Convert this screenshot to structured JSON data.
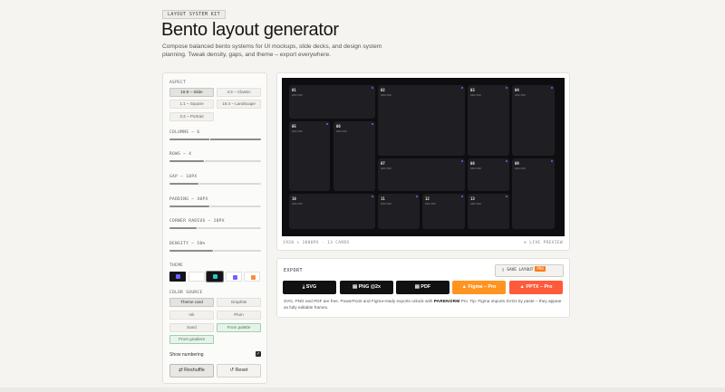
{
  "header": {
    "tag": "LAYOUT SYSTEM KIT",
    "title": "Bento layout generator",
    "subtitle": "Compose balanced bento systems for UI mockups, slide decks, and design system planning. Tweak density, gaps, and theme – export everywhere."
  },
  "controls": {
    "aspect_label": "ASPECT",
    "aspects": [
      "16:9 – Slide",
      "4:3 – Classic",
      "1:1 – Square",
      "16:4 – Landscape",
      "3:4 – Portrait"
    ],
    "columns_label": "COLUMNS – 6",
    "rows_label": "ROWS – 4",
    "gap_label": "GAP – 18PX",
    "padding_label": "PADDING – 40PX",
    "radius_label": "CORNER RADIUS – 20PX",
    "density_label": "DENSITY – 50%",
    "theme_label": "THEME",
    "theme_colors": [
      "#6b63ff",
      "#ffffff",
      "#2ec5c5",
      "#6b63ff",
      "#ff8a3d"
    ],
    "color_source_label": "COLOR SOURCE",
    "color_sources": [
      "Theme card",
      "Graphite",
      "Ink",
      "Plum",
      "Sand",
      "From palette",
      "From gradient"
    ],
    "numbering_label": "Show numbering",
    "reshuffle": "Reshuffle",
    "reset": "Reset"
  },
  "preview": {
    "cells": [
      {
        "n": "01",
        "m": "640×360"
      },
      {
        "n": "02",
        "m": "640×360"
      },
      {
        "n": "03",
        "m": "640×360"
      },
      {
        "n": "04",
        "m": "640×360"
      },
      {
        "n": "05",
        "m": "640×360"
      },
      {
        "n": "06",
        "m": "640×360"
      },
      {
        "n": "07",
        "m": "640×360"
      },
      {
        "n": "08",
        "m": "640×360"
      },
      {
        "n": "09",
        "m": "640×360"
      },
      {
        "n": "10",
        "m": "640×360"
      },
      {
        "n": "11",
        "m": "640×360"
      },
      {
        "n": "12",
        "m": "640×360"
      },
      {
        "n": "13",
        "m": "640×360"
      }
    ],
    "footer_left": "1920 × 1080PX · 13 CARDS",
    "footer_right": "LIVE PREVIEW"
  },
  "export": {
    "title": "EXPORT",
    "save_label": "SAVE LAYOUT",
    "pro_badge": "PRO",
    "buttons": [
      "SVG",
      "PNG @2x",
      "PDF",
      "Figma – Pro",
      "PPTX – Pro"
    ],
    "note_prefix": "SVG, PNG and PDF are free. PowerPoint and Figma-ready exports unlock with ",
    "note_brand": "PARENORM",
    "note_suffix": " Pro. Tip: Figma imports SVGs by paste – they appear as fully editable frames."
  }
}
